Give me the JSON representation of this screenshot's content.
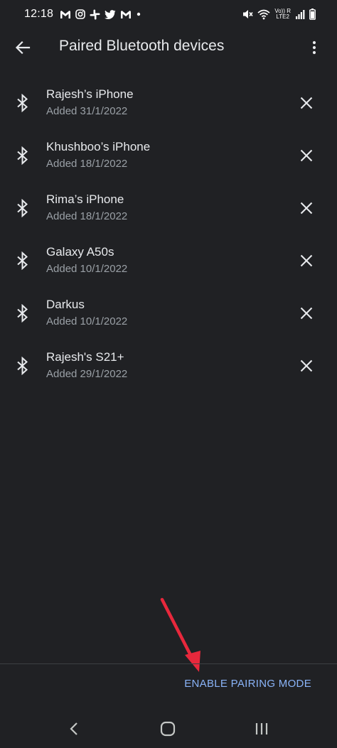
{
  "status_bar": {
    "time": "12:18",
    "left_icons": [
      "gmail-icon",
      "instagram-icon",
      "slack-icon",
      "twitter-icon",
      "gmail-icon",
      "dot-icon"
    ],
    "right_icons": [
      "mute-icon",
      "wifi-icon",
      "volte-icon",
      "signal-icon",
      "battery-icon"
    ],
    "volte_label": "Vo)) R",
    "lte_label": "LTE2"
  },
  "app_bar": {
    "title": "Paired Bluetooth devices",
    "back_icon": "arrow-back-icon",
    "overflow_icon": "more-vert-icon"
  },
  "devices": [
    {
      "name": "Rajesh’s iPhone",
      "added": "Added 31/1/2022"
    },
    {
      "name": "Khushboo’s iPhone",
      "added": "Added 18/1/2022"
    },
    {
      "name": "Rima’s iPhone",
      "added": "Added 18/1/2022"
    },
    {
      "name": "Galaxy A50s",
      "added": "Added 10/1/2022"
    },
    {
      "name": "Darkus",
      "added": "Added 10/1/2022"
    },
    {
      "name": "Rajesh's S21+",
      "added": "Added 29/1/2022"
    }
  ],
  "actions": {
    "enable_pairing": "ENABLE PAIRING MODE"
  },
  "colors": {
    "background": "#202124",
    "accent": "#8ab4f8",
    "text_primary": "#e8eaed",
    "text_secondary": "#9aa0a6",
    "annotation": "#e8283c"
  },
  "nav_bar": {
    "icons": [
      "nav-back-icon",
      "nav-home-icon",
      "nav-recents-icon"
    ]
  }
}
